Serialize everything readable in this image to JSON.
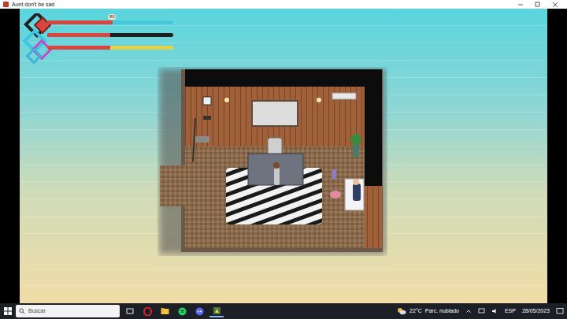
{
  "window": {
    "title": "Aunt don't be sad"
  },
  "hud": {
    "label": "80",
    "bars": [
      {
        "level": 0.52,
        "color": "#45c8dc"
      },
      {
        "level": 0.5,
        "color": "#1e1e1e"
      },
      {
        "level": 0.5,
        "color": "#e3d34a"
      }
    ]
  },
  "taskbar": {
    "search": {
      "placeholder": "Buscar"
    },
    "weather": {
      "temp": "22°C",
      "text": "Parc. nublado"
    },
    "language": "ESP",
    "date": "28/05/2023"
  }
}
